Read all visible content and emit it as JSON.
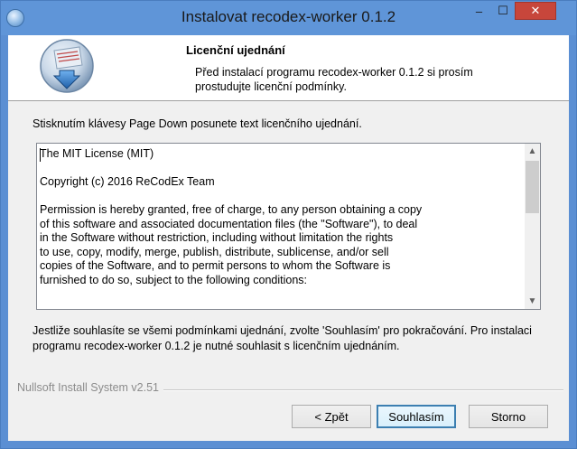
{
  "window": {
    "title": "Instalovat recodex-worker 0.1.2",
    "controls": {
      "minimize": "–",
      "maximize": "☐",
      "close": "✕"
    }
  },
  "header": {
    "title": "Licenční ujednání",
    "subtitle": "Před instalací programu recodex-worker 0.1.2 si prosím prostudujte licenční podmínky."
  },
  "instruction": "Stisknutím klávesy Page Down posunete text licenčního ujednání.",
  "license": {
    "lines": [
      "The MIT License (MIT)",
      "",
      "Copyright (c) 2016 ReCodEx Team",
      "",
      "Permission is hereby granted, free of charge, to any person obtaining a copy",
      "of this software and associated documentation files (the \"Software\"), to deal",
      "in the Software without restriction, including without limitation the rights",
      "to use, copy, modify, merge, publish, distribute, sublicense, and/or sell",
      "copies of the Software, and to permit persons to whom the Software is",
      "furnished to do so, subject to the following conditions:"
    ]
  },
  "agreement_text": "Jestliže souhlasíte se všemi podmínkami ujednání, zvolte 'Souhlasím' pro pokračování. Pro instalaci programu recodex-worker 0.1.2 je nutné souhlasit s licenčním ujednáním.",
  "branding": "Nullsoft Install System v2.51",
  "buttons": {
    "back": "< Zpět",
    "agree": "Souhlasím",
    "cancel": "Storno"
  }
}
